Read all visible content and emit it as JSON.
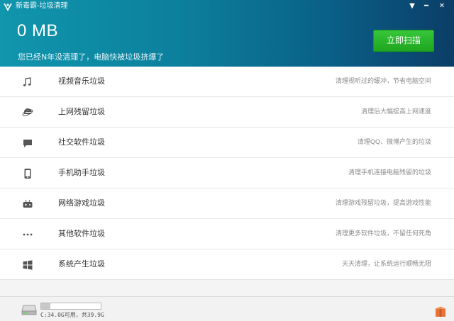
{
  "titlebar": {
    "title": "新毒霸-垃圾清理",
    "menu_glyph": "▼",
    "minimize_glyph": "━",
    "close_glyph": "✕"
  },
  "header": {
    "size": "0 MB",
    "subtitle": "您已经N年没清理了，电脑快被垃圾挤爆了",
    "scan_button": "立即扫描"
  },
  "colors": {
    "header_start": "#1096ad",
    "header_end": "#0b3d66",
    "scan_green": "#22ab22",
    "icon_gray": "#555555",
    "footer_box": "#e8743b"
  },
  "categories": [
    {
      "icon": "music-note-icon",
      "name": "视频音乐垃圾",
      "desc": "清理视听过的缓冲，节省电脑空间"
    },
    {
      "icon": "ie-browser-icon",
      "name": "上网残留垃圾",
      "desc": "清理后大幅提高上网速度"
    },
    {
      "icon": "chat-bubble-icon",
      "name": "社交软件垃圾",
      "desc": "清理QQ、微博产生的垃圾"
    },
    {
      "icon": "phone-icon",
      "name": "手机助手垃圾",
      "desc": "清理手机连接电脑残留的垃圾"
    },
    {
      "icon": "game-controller-icon",
      "name": "网络游戏垃圾",
      "desc": "清理游戏残留垃圾，提高游戏性能"
    },
    {
      "icon": "more-dots-icon",
      "name": "其他软件垃圾",
      "desc": "清理更多软件垃圾，不留任何死角"
    },
    {
      "icon": "windows-logo-icon",
      "name": "系统产生垃圾",
      "desc": "天天清理，让系统运行顺畅无阻"
    }
  ],
  "footer": {
    "disk_text": "C:34.0G可用，共39.9G",
    "disk_used_fraction": 0.15
  }
}
